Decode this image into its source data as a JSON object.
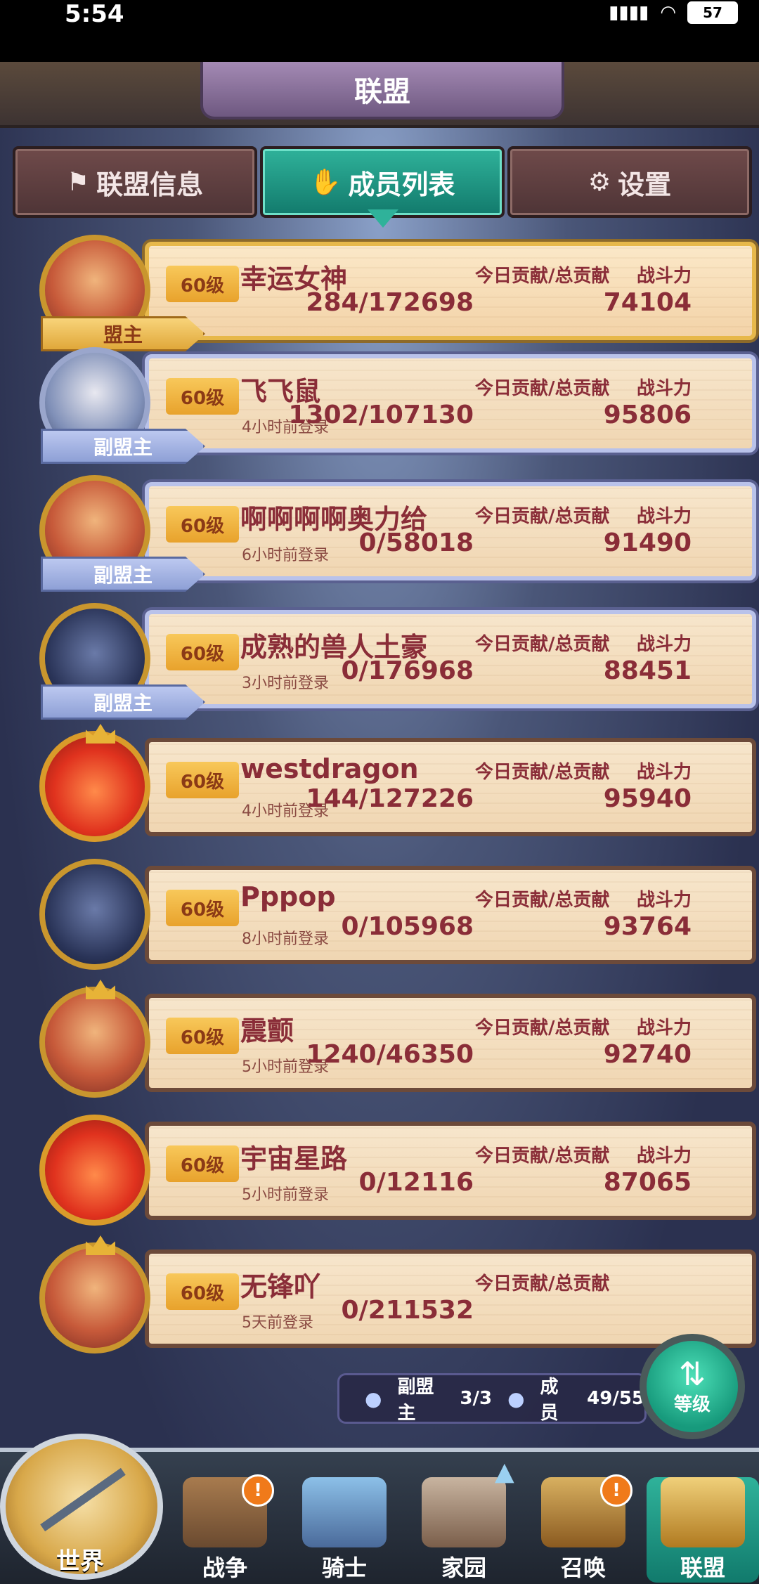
{
  "status_bar": {
    "time": "5:54",
    "battery": "57"
  },
  "title": "联盟",
  "tabs": [
    {
      "label": "联盟信息",
      "icon": "flag-icon"
    },
    {
      "label": "成员列表",
      "icon": "handshake-icon"
    },
    {
      "label": "设置",
      "icon": "gear-icon"
    }
  ],
  "columns": {
    "contribution": "今日贡献/总贡献",
    "power": "战斗力"
  },
  "members": [
    {
      "level": "60级",
      "name": "幸运女神",
      "login": "",
      "contribution": "284/172698",
      "power": "74104",
      "role": "盟主"
    },
    {
      "level": "60级",
      "name": "飞飞鼠",
      "login": "4小时前登录",
      "contribution": "1302/107130",
      "power": "95806",
      "role": "副盟主"
    },
    {
      "level": "60级",
      "name": "啊啊啊啊奥力给",
      "login": "6小时前登录",
      "contribution": "0/58018",
      "power": "91490",
      "role": "副盟主"
    },
    {
      "level": "60级",
      "name": "成熟的兽人土豪",
      "login": "3小时前登录",
      "contribution": "0/176968",
      "power": "88451",
      "role": "副盟主"
    },
    {
      "level": "60级",
      "name": "westdragon",
      "login": "4小时前登录",
      "contribution": "144/127226",
      "power": "95940",
      "role": ""
    },
    {
      "level": "60级",
      "name": "Pppop",
      "login": "8小时前登录",
      "contribution": "0/105968",
      "power": "93764",
      "role": ""
    },
    {
      "level": "60级",
      "name": "震颤",
      "login": "5小时前登录",
      "contribution": "1240/46350",
      "power": "92740",
      "role": ""
    },
    {
      "level": "60级",
      "name": "宇宙星路",
      "login": "5小时前登录",
      "contribution": "0/12116",
      "power": "87065",
      "role": ""
    },
    {
      "level": "60级",
      "name": "无锋吖",
      "login": "5天前登录",
      "contribution": "0/211532",
      "power": "",
      "role": ""
    }
  ],
  "member_summary": {
    "vice_label": "副盟主",
    "vice_count": "3/3",
    "member_label": "成员",
    "member_count": "49/55"
  },
  "sort_button": "等级",
  "bottom_nav": [
    {
      "label": "世界"
    },
    {
      "label": "战争",
      "alert": "!"
    },
    {
      "label": "骑士"
    },
    {
      "label": "家园"
    },
    {
      "label": "召唤",
      "alert": "!"
    },
    {
      "label": "联盟"
    }
  ]
}
